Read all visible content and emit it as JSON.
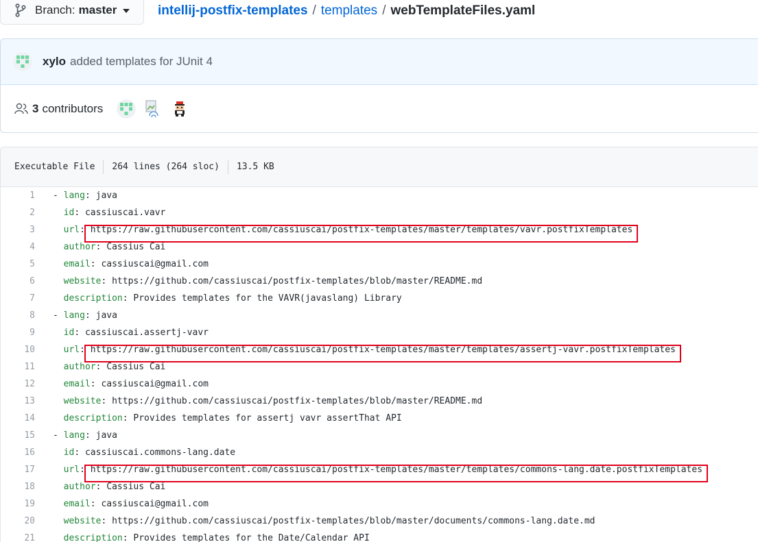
{
  "branch": {
    "prefix": "Branch:",
    "name": "master"
  },
  "breadcrumb": {
    "repo": "intellij-postfix-templates",
    "folder": "templates",
    "file": "webTemplateFiles.yaml",
    "separator": "/"
  },
  "commit": {
    "author": "xylo",
    "message": "added templates for JUnit 4"
  },
  "contributors": {
    "count": "3",
    "label": "contributors"
  },
  "file_meta": {
    "mode": "Executable File",
    "lines": "264 lines (264 sloc)",
    "size": "13.5 KB"
  },
  "colors": {
    "link": "#0366d6",
    "highlight": "#e0001b",
    "yaml_key": "#22863a"
  },
  "code": [
    {
      "n": "1",
      "dash": "- ",
      "key": "lang",
      "value": "java"
    },
    {
      "n": "2",
      "dash": "  ",
      "key": "id",
      "value": "cassiuscai.vavr"
    },
    {
      "n": "3",
      "dash": "  ",
      "key": "url",
      "value": "https://raw.githubusercontent.com/cassiuscai/postfix-templates/master/templates/vavr.postfixTemplates",
      "highlighted": true
    },
    {
      "n": "4",
      "dash": "  ",
      "key": "author",
      "value": "Cassius Cai"
    },
    {
      "n": "5",
      "dash": "  ",
      "key": "email",
      "value": "cassiuscai@gmail.com"
    },
    {
      "n": "6",
      "dash": "  ",
      "key": "website",
      "value": "https://github.com/cassiuscai/postfix-templates/blob/master/README.md"
    },
    {
      "n": "7",
      "dash": "  ",
      "key": "description",
      "value": "Provides templates for the VAVR(javaslang) Library"
    },
    {
      "n": "8",
      "dash": "- ",
      "key": "lang",
      "value": "java"
    },
    {
      "n": "9",
      "dash": "  ",
      "key": "id",
      "value": "cassiuscai.assertj-vavr"
    },
    {
      "n": "10",
      "dash": "  ",
      "key": "url",
      "value": "https://raw.githubusercontent.com/cassiuscai/postfix-templates/master/templates/assertj-vavr.postfixTemplates",
      "highlighted": true
    },
    {
      "n": "11",
      "dash": "  ",
      "key": "author",
      "value": "Cassius Cai"
    },
    {
      "n": "12",
      "dash": "  ",
      "key": "email",
      "value": "cassiuscai@gmail.com"
    },
    {
      "n": "13",
      "dash": "  ",
      "key": "website",
      "value": "https://github.com/cassiuscai/postfix-templates/blob/master/README.md"
    },
    {
      "n": "14",
      "dash": "  ",
      "key": "description",
      "value": "Provides templates for assertj vavr assertThat API"
    },
    {
      "n": "15",
      "dash": "- ",
      "key": "lang",
      "value": "java"
    },
    {
      "n": "16",
      "dash": "  ",
      "key": "id",
      "value": "cassiuscai.commons-lang.date"
    },
    {
      "n": "17",
      "dash": "  ",
      "key": "url",
      "value": "https://raw.githubusercontent.com/cassiuscai/postfix-templates/master/templates/commons-lang.date.postfixTemplates",
      "highlighted": true
    },
    {
      "n": "18",
      "dash": "  ",
      "key": "author",
      "value": "Cassius Cai"
    },
    {
      "n": "19",
      "dash": "  ",
      "key": "email",
      "value": "cassiuscai@gmail.com"
    },
    {
      "n": "20",
      "dash": "  ",
      "key": "website",
      "value": "https://github.com/cassiuscai/postfix-templates/blob/master/documents/commons-lang.date.md"
    },
    {
      "n": "21",
      "dash": "  ",
      "key": "description",
      "value": "Provides templates for the Date/Calendar API"
    }
  ]
}
